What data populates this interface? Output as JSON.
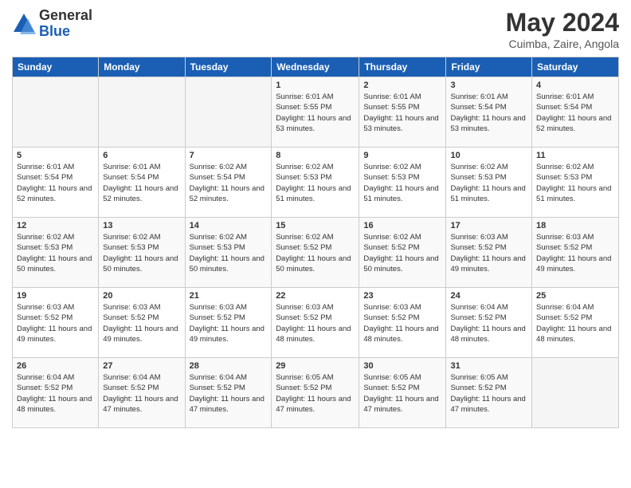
{
  "logo": {
    "general": "General",
    "blue": "Blue"
  },
  "title": "May 2024",
  "subtitle": "Cuimba, Zaire, Angola",
  "weekdays": [
    "Sunday",
    "Monday",
    "Tuesday",
    "Wednesday",
    "Thursday",
    "Friday",
    "Saturday"
  ],
  "weeks": [
    [
      {
        "day": "",
        "info": ""
      },
      {
        "day": "",
        "info": ""
      },
      {
        "day": "",
        "info": ""
      },
      {
        "day": "1",
        "info": "Sunrise: 6:01 AM\nSunset: 5:55 PM\nDaylight: 11 hours and 53 minutes."
      },
      {
        "day": "2",
        "info": "Sunrise: 6:01 AM\nSunset: 5:55 PM\nDaylight: 11 hours and 53 minutes."
      },
      {
        "day": "3",
        "info": "Sunrise: 6:01 AM\nSunset: 5:54 PM\nDaylight: 11 hours and 53 minutes."
      },
      {
        "day": "4",
        "info": "Sunrise: 6:01 AM\nSunset: 5:54 PM\nDaylight: 11 hours and 52 minutes."
      }
    ],
    [
      {
        "day": "5",
        "info": "Sunrise: 6:01 AM\nSunset: 5:54 PM\nDaylight: 11 hours and 52 minutes."
      },
      {
        "day": "6",
        "info": "Sunrise: 6:01 AM\nSunset: 5:54 PM\nDaylight: 11 hours and 52 minutes."
      },
      {
        "day": "7",
        "info": "Sunrise: 6:02 AM\nSunset: 5:54 PM\nDaylight: 11 hours and 52 minutes."
      },
      {
        "day": "8",
        "info": "Sunrise: 6:02 AM\nSunset: 5:53 PM\nDaylight: 11 hours and 51 minutes."
      },
      {
        "day": "9",
        "info": "Sunrise: 6:02 AM\nSunset: 5:53 PM\nDaylight: 11 hours and 51 minutes."
      },
      {
        "day": "10",
        "info": "Sunrise: 6:02 AM\nSunset: 5:53 PM\nDaylight: 11 hours and 51 minutes."
      },
      {
        "day": "11",
        "info": "Sunrise: 6:02 AM\nSunset: 5:53 PM\nDaylight: 11 hours and 51 minutes."
      }
    ],
    [
      {
        "day": "12",
        "info": "Sunrise: 6:02 AM\nSunset: 5:53 PM\nDaylight: 11 hours and 50 minutes."
      },
      {
        "day": "13",
        "info": "Sunrise: 6:02 AM\nSunset: 5:53 PM\nDaylight: 11 hours and 50 minutes."
      },
      {
        "day": "14",
        "info": "Sunrise: 6:02 AM\nSunset: 5:53 PM\nDaylight: 11 hours and 50 minutes."
      },
      {
        "day": "15",
        "info": "Sunrise: 6:02 AM\nSunset: 5:52 PM\nDaylight: 11 hours and 50 minutes."
      },
      {
        "day": "16",
        "info": "Sunrise: 6:02 AM\nSunset: 5:52 PM\nDaylight: 11 hours and 50 minutes."
      },
      {
        "day": "17",
        "info": "Sunrise: 6:03 AM\nSunset: 5:52 PM\nDaylight: 11 hours and 49 minutes."
      },
      {
        "day": "18",
        "info": "Sunrise: 6:03 AM\nSunset: 5:52 PM\nDaylight: 11 hours and 49 minutes."
      }
    ],
    [
      {
        "day": "19",
        "info": "Sunrise: 6:03 AM\nSunset: 5:52 PM\nDaylight: 11 hours and 49 minutes."
      },
      {
        "day": "20",
        "info": "Sunrise: 6:03 AM\nSunset: 5:52 PM\nDaylight: 11 hours and 49 minutes."
      },
      {
        "day": "21",
        "info": "Sunrise: 6:03 AM\nSunset: 5:52 PM\nDaylight: 11 hours and 49 minutes."
      },
      {
        "day": "22",
        "info": "Sunrise: 6:03 AM\nSunset: 5:52 PM\nDaylight: 11 hours and 48 minutes."
      },
      {
        "day": "23",
        "info": "Sunrise: 6:03 AM\nSunset: 5:52 PM\nDaylight: 11 hours and 48 minutes."
      },
      {
        "day": "24",
        "info": "Sunrise: 6:04 AM\nSunset: 5:52 PM\nDaylight: 11 hours and 48 minutes."
      },
      {
        "day": "25",
        "info": "Sunrise: 6:04 AM\nSunset: 5:52 PM\nDaylight: 11 hours and 48 minutes."
      }
    ],
    [
      {
        "day": "26",
        "info": "Sunrise: 6:04 AM\nSunset: 5:52 PM\nDaylight: 11 hours and 48 minutes."
      },
      {
        "day": "27",
        "info": "Sunrise: 6:04 AM\nSunset: 5:52 PM\nDaylight: 11 hours and 47 minutes."
      },
      {
        "day": "28",
        "info": "Sunrise: 6:04 AM\nSunset: 5:52 PM\nDaylight: 11 hours and 47 minutes."
      },
      {
        "day": "29",
        "info": "Sunrise: 6:05 AM\nSunset: 5:52 PM\nDaylight: 11 hours and 47 minutes."
      },
      {
        "day": "30",
        "info": "Sunrise: 6:05 AM\nSunset: 5:52 PM\nDaylight: 11 hours and 47 minutes."
      },
      {
        "day": "31",
        "info": "Sunrise: 6:05 AM\nSunset: 5:52 PM\nDaylight: 11 hours and 47 minutes."
      },
      {
        "day": "",
        "info": ""
      }
    ]
  ]
}
